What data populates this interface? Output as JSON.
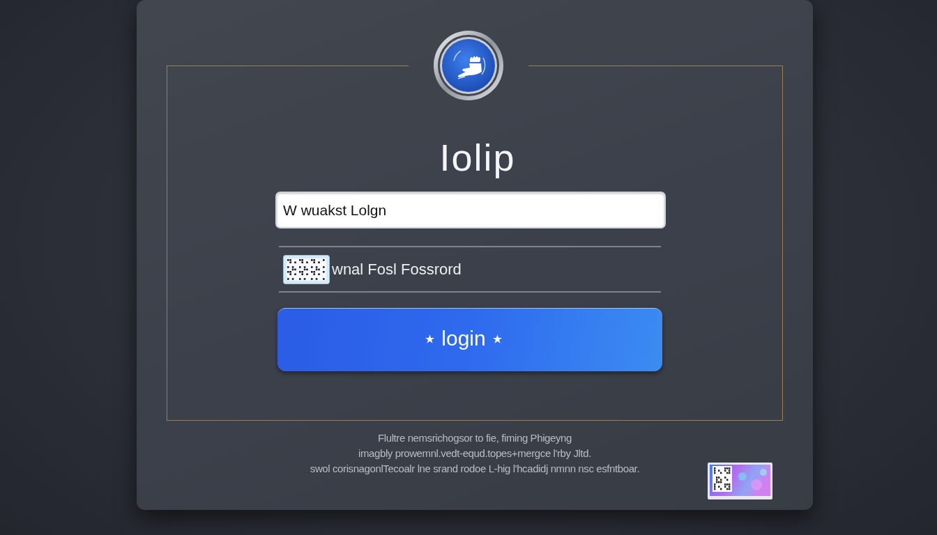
{
  "title": "Iolip",
  "text_field": {
    "value": "W wuakst Lolgn"
  },
  "underlined_field": {
    "value": "wnal Fosl Fossrord"
  },
  "login_button": {
    "label": "login"
  },
  "footer_text": [
    "Flultre nemsrichogsor to fie, fiming Phigeyng",
    "imagbly prowemnl.vedt-equd.topes+mergce l'rby Jltd.",
    "swol corisnagonlTecoalr lne srand rodoe L-hig l'hcadidj nmnn nsc esfntboar."
  ]
}
